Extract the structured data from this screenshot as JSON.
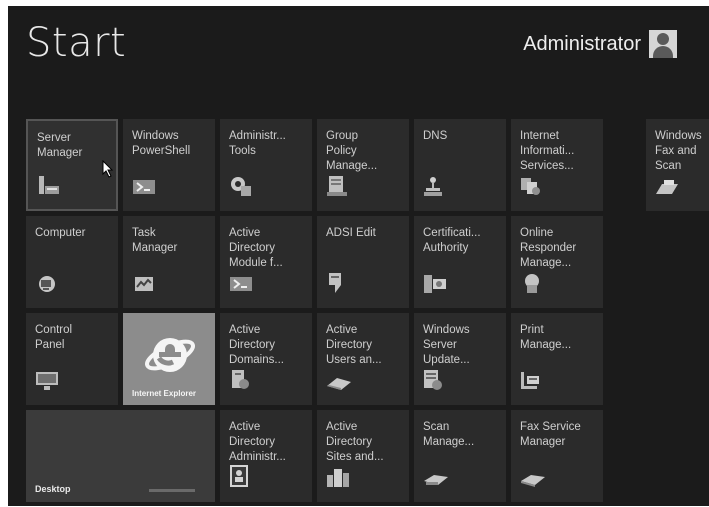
{
  "header": {
    "title": "Start",
    "user_name": "Administrator"
  },
  "tiles": [
    {
      "label": "Server\nManager",
      "icon": "server-manager-icon"
    },
    {
      "label": "Windows\nPowerShell",
      "icon": "powershell-icon"
    },
    {
      "label": "Administr...\nTools",
      "icon": "admin-tools-icon"
    },
    {
      "label": "Group\nPolicy\nManage...",
      "icon": "group-policy-icon"
    },
    {
      "label": "DNS",
      "icon": "dns-icon"
    },
    {
      "label": "Internet\nInformati...\nServices...",
      "icon": "iis-icon"
    },
    {
      "label": "Windows\nFax and\nScan",
      "icon": "fax-scan-icon"
    },
    {
      "label": "Computer",
      "icon": "computer-icon"
    },
    {
      "label": "Task\nManager",
      "icon": "task-manager-icon"
    },
    {
      "label": "Active\nDirectory\nModule f...",
      "icon": "ad-module-icon"
    },
    {
      "label": "ADSI Edit",
      "icon": "adsi-edit-icon"
    },
    {
      "label": "Certificati...\nAuthority",
      "icon": "cert-authority-icon"
    },
    {
      "label": "Online\nResponder\nManage...",
      "icon": "online-responder-icon"
    },
    {
      "label": "Control\nPanel",
      "icon": "control-panel-icon"
    },
    {
      "label": "Internet Explorer",
      "icon": "internet-explorer-icon"
    },
    {
      "label": "Active\nDirectory\nDomains...",
      "icon": "ad-domains-icon"
    },
    {
      "label": "Active\nDirectory\nUsers an...",
      "icon": "ad-users-icon"
    },
    {
      "label": "Windows\nServer\nUpdate...",
      "icon": "wsus-icon"
    },
    {
      "label": "Print\nManage...",
      "icon": "print-manager-icon"
    },
    {
      "label": "Desktop",
      "icon": "desktop-tile"
    },
    {
      "label": "Active\nDirectory\nAdministr...",
      "icon": "ad-admin-center-icon"
    },
    {
      "label": "Active\nDirectory\nSites and...",
      "icon": "ad-sites-icon"
    },
    {
      "label": "Scan\nManage...",
      "icon": "scan-manager-icon"
    },
    {
      "label": "Fax Service\nManager",
      "icon": "fax-service-icon"
    }
  ]
}
